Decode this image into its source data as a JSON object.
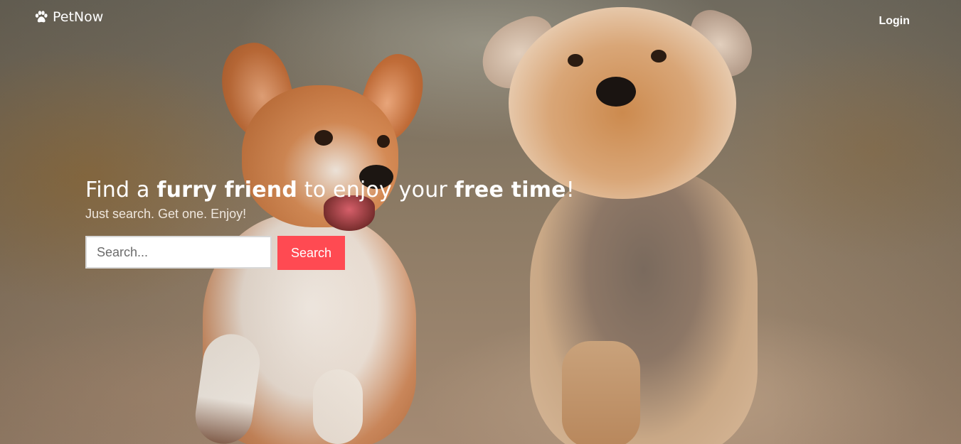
{
  "navbar": {
    "brand_icon": "paw-icon",
    "brand_name": "PetNow",
    "login_label": "Login"
  },
  "hero": {
    "headline": {
      "part1": "Find a ",
      "bold1": "furry friend",
      "part2": " to enjoy your ",
      "bold2": "free time",
      "part3": "!"
    },
    "tagline": "Just search. Get one. Enjoy!",
    "search": {
      "placeholder": "Search...",
      "value": "",
      "button_label": "Search"
    },
    "background_image": "two-dogs-running-photo"
  },
  "colors": {
    "accent": "#ff4a52",
    "text_on_hero": "#ffffff"
  }
}
